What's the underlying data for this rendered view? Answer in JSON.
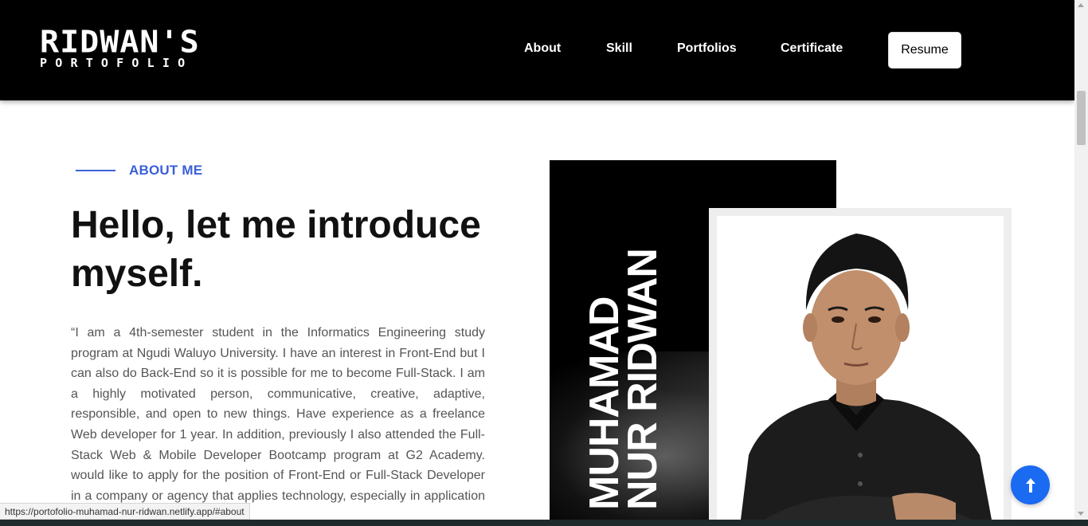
{
  "nav": {
    "logo_top": "RIDWAN'S",
    "logo_bottom": "PORTOFOLIO",
    "links": [
      {
        "label": "About"
      },
      {
        "label": "Skill"
      },
      {
        "label": "Portfolios"
      },
      {
        "label": "Certificate"
      }
    ],
    "resume_label": "Resume"
  },
  "about": {
    "eyebrow": "ABOUT ME",
    "headline": "Hello, let me introduce myself.",
    "bio": "“I am a 4th-semester student in the Informatics Engineering study program at Ngudi Waluyo University. I have an interest in Front-End but I can also do Back-End so it is possible for me to become Full-Stack. I am a highly motivated person, communicative, creative, adaptive, responsible, and open to new things. Have experience as a freelance Web developer for 1 year. In addition, previously I also attended the Full-Stack Web & Mobile Developer Bootcamp program at G2 Academy. would like to apply for the position of Front-End or Full-Stack Developer in a company or agency that applies technology, especially in application or website"
  },
  "photo": {
    "name_line1": "MUHAMAD",
    "name_line2": "NUR RIDWAN"
  },
  "status_url": "https://portofolio-muhamad-nur-ridwan.netlify.app/#about",
  "colors": {
    "accent": "#3b5fd9",
    "fab": "#1a6af2",
    "nav_bg": "#000000"
  },
  "icons": {
    "fab": "arrow-up-icon"
  }
}
